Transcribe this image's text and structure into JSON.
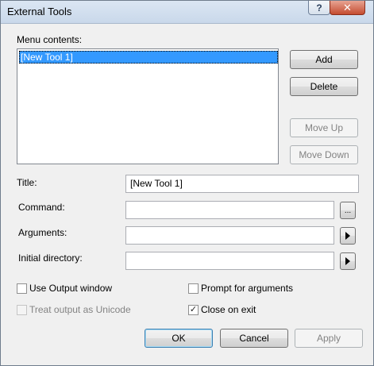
{
  "window": {
    "title": "External Tools",
    "help_glyph": "?",
    "close_glyph": "✕"
  },
  "menu": {
    "label": "Menu contents:",
    "items": [
      "[New Tool 1]"
    ],
    "selected_index": 0
  },
  "side_buttons": {
    "add": "Add",
    "delete": "Delete",
    "move_up": "Move Up",
    "move_down": "Move Down"
  },
  "fields": {
    "title_label": "Title:",
    "title_value": "[New Tool 1]",
    "command_label": "Command:",
    "command_value": "",
    "command_browse": "...",
    "arguments_label": "Arguments:",
    "arguments_value": "",
    "initial_dir_label": "Initial directory:",
    "initial_dir_value": ""
  },
  "options": {
    "use_output_window": {
      "label": "Use Output window",
      "checked": false,
      "enabled": true
    },
    "prompt_for_arguments": {
      "label": "Prompt for arguments",
      "checked": false,
      "enabled": true
    },
    "treat_output_unicode": {
      "label": "Treat output as Unicode",
      "checked": false,
      "enabled": false
    },
    "close_on_exit": {
      "label": "Close on exit",
      "checked": true,
      "enabled": true
    }
  },
  "footer": {
    "ok": "OK",
    "cancel": "Cancel",
    "apply": "Apply"
  },
  "icons": {
    "check_glyph": "✓"
  }
}
